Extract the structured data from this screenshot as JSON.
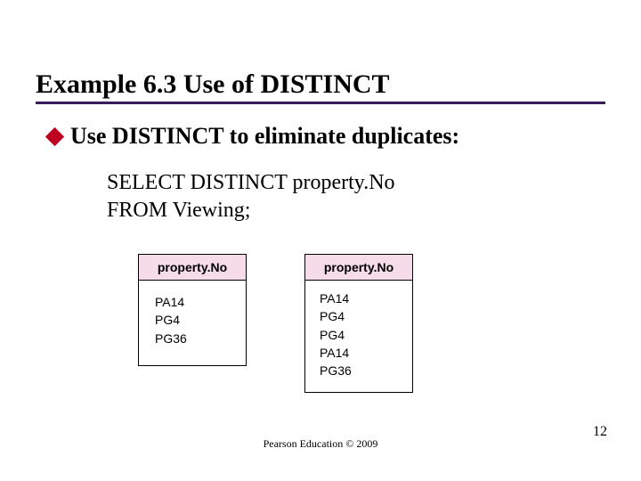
{
  "title": "Example 6.3  Use of DISTINCT",
  "bullet": "Use DISTINCT to eliminate duplicates:",
  "code": {
    "line1": "SELECT DISTINCT property.No",
    "line2": "FROM Viewing;"
  },
  "table_left": {
    "header": "property.No",
    "rows": [
      "PA14",
      "PG4",
      "PG36"
    ]
  },
  "table_right": {
    "header": "property.No",
    "rows": [
      "PA14",
      "PG4",
      "PG4",
      "PA14",
      "PG36"
    ]
  },
  "footer": "Pearson Education © 2009",
  "page_number": "12"
}
